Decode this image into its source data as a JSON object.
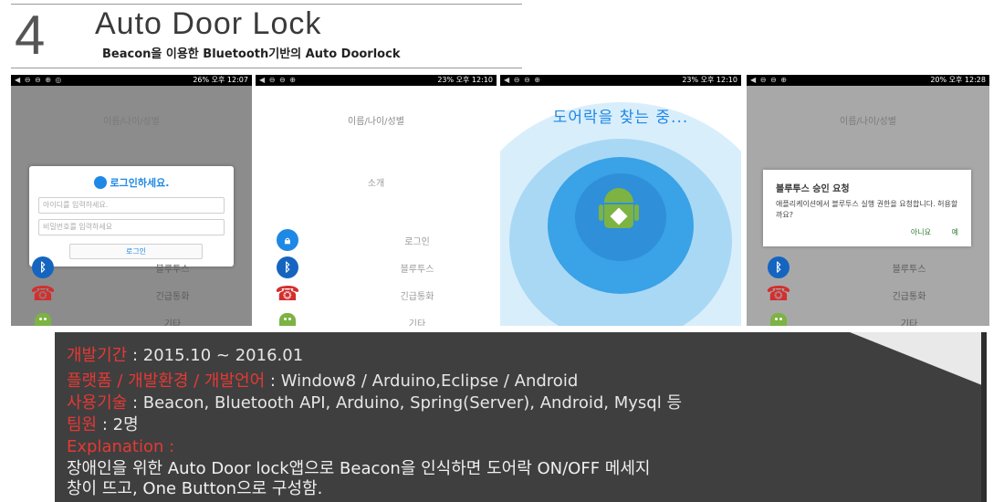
{
  "header": {
    "number": "4",
    "title": "Auto Door Lock",
    "subtitle": "Beacon을 이용한 Bluetooth기반의 Auto Doorlock"
  },
  "phones": [
    {
      "status_left": "◀ ⊖ ⊖ ⊕ ◎",
      "status_right": "26% 오후 12:07",
      "menu_head": "이름/나이/성별",
      "dialog": {
        "title": "로그인하세요.",
        "id_placeholder": "아이디를 입력하세요.",
        "pw_placeholder": "비밀번호를 입력하세요",
        "button": "로그인"
      },
      "menu": [
        {
          "icon": "bluetooth-icon",
          "label": "블루투스"
        },
        {
          "icon": "phone-icon",
          "label": "긴급통화"
        },
        {
          "icon": "android-icon",
          "label": "기타"
        }
      ]
    },
    {
      "status_left": "◀ ⊖ ⊖ ⊕",
      "status_right": "23% 오후 12:10",
      "menu_head": "이름/나이/성별",
      "intro": "소개",
      "menu": [
        {
          "icon": "lock-icon",
          "label": "로그인"
        },
        {
          "icon": "bluetooth-icon",
          "label": "블루투스"
        },
        {
          "icon": "phone-icon",
          "label": "긴급통화"
        },
        {
          "icon": "android-icon",
          "label": "기타"
        }
      ]
    },
    {
      "status_left": "◀ ⊖ ⊖ ⊕",
      "status_right": "23% 오후 12:10",
      "scan_text": "도어락을 찾는 중..."
    },
    {
      "status_left": "◀ ⊖ ⊖ ⊕",
      "status_right": "20% 오후 12:28",
      "menu_head": "이름/나이/성별",
      "dialog": {
        "title": "블루투스 승인 요청",
        "message": "애플리케이션에서 블루투스 실행 권한을 요청합니다. 허용할까요?",
        "no": "아니요",
        "yes": "예"
      },
      "menu": [
        {
          "icon": "bluetooth-icon",
          "label": "블루투스"
        },
        {
          "icon": "phone-icon",
          "label": "긴급통화"
        },
        {
          "icon": "android-icon",
          "label": "기타"
        }
      ]
    }
  ],
  "info": {
    "period_key": "개발기간",
    "period_val": " : 2015.10 ~ 2016.01",
    "platform_key": "플랫폼 / 개발환경 / 개발언어",
    "platform_val": " : Window8 / Arduino,Eclipse / Android",
    "tech_key": "사용기술",
    "tech_val": " : Beacon, Bluetooth API, Arduino, Spring(Server), Android, Mysql 등",
    "team_key": "팀원",
    "team_val": " : 2명",
    "explanation_key": "Explanation :",
    "desc_line1": "장애인을 위한 Auto Door lock앱으로 Beacon을 인식하면 도어락 ON/OFF 메세지",
    "desc_line2": "창이 뜨고, One Button으로 구성함."
  },
  "colors": {
    "accent_blue": "#1e88e5",
    "key_red": "#e53935",
    "panel_bg": "#3f3f3f",
    "android_green": "#7cb342"
  }
}
